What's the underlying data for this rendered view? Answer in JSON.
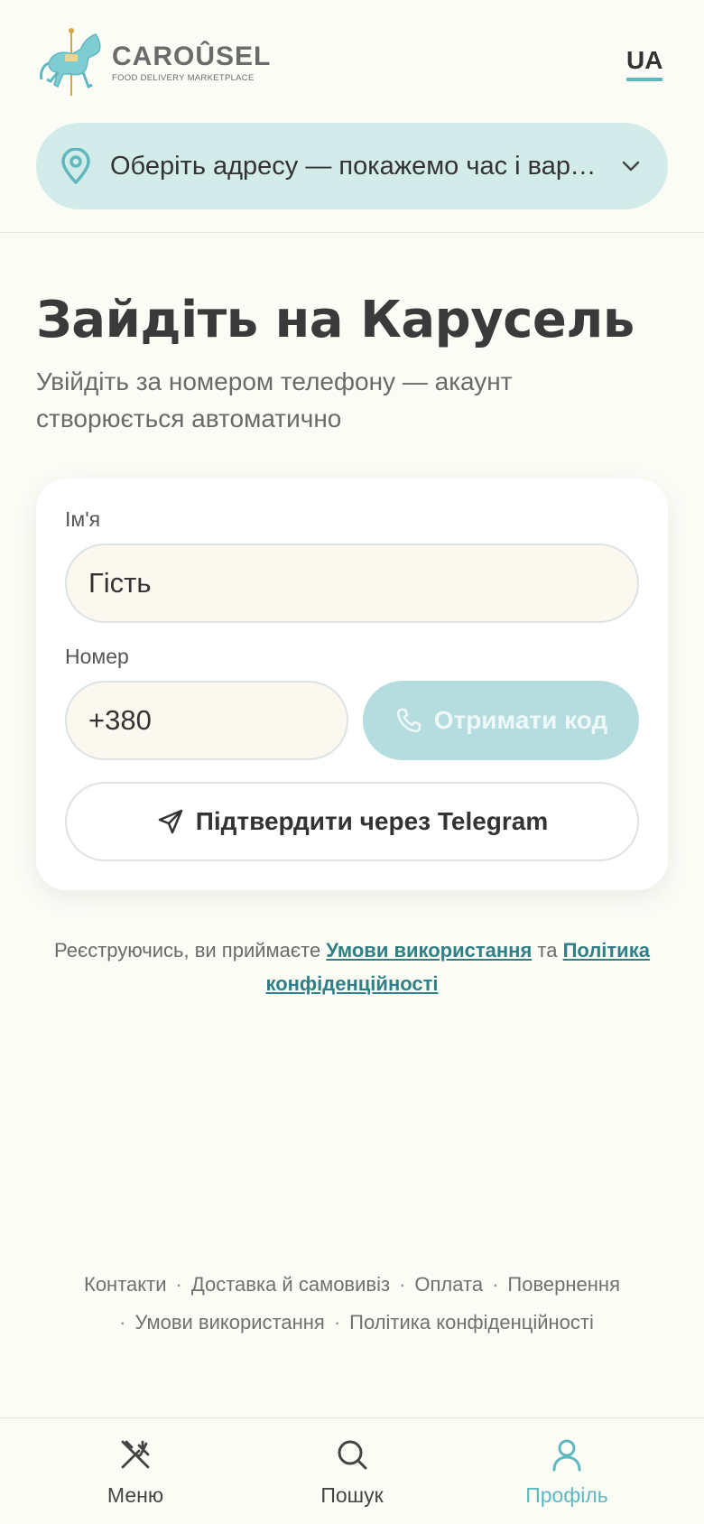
{
  "header": {
    "brand_name": "CAROÛSEL",
    "brand_tagline": "FOOD DELIVERY MARKETPLACE",
    "language": "UA",
    "address_text": "Оберіть адресу — покажемо час і вартість доставки"
  },
  "main": {
    "title": "Зайдіть на Карусель",
    "subtitle": "Увійдіть за номером телефону — акаунт створюється автоматично"
  },
  "form": {
    "name_label": "Ім'я",
    "name_value": "Гість",
    "phone_label": "Номер",
    "phone_value": "+380",
    "get_code_label": "Отримати код",
    "telegram_label": "Підтвердити через Telegram"
  },
  "terms": {
    "prefix": "Реєструючись, ви приймаєте ",
    "terms_link": "Умови використання",
    "middle": " та ",
    "privacy_link": "Політика конфіденційності"
  },
  "footer": {
    "links": [
      "Контакти",
      "Доставка й самовивіз",
      "Оплата",
      "Повернення",
      "Умови використання",
      "Політика конфіденційності"
    ]
  },
  "nav": {
    "items": [
      {
        "label": "Меню",
        "icon": "utensils-icon"
      },
      {
        "label": "Пошук",
        "icon": "search-icon"
      },
      {
        "label": "Профіль",
        "icon": "user-icon"
      }
    ]
  },
  "colors": {
    "accent": "#5fb8bf",
    "accent_light": "#d3ecea",
    "link": "#2f7f86",
    "background": "#fcfcf7"
  }
}
